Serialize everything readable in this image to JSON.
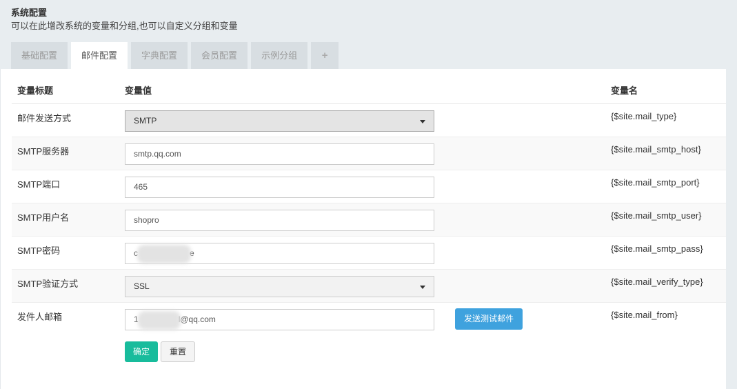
{
  "header": {
    "title": "系统配置",
    "description": "可以在此增改系统的变量和分组,也可以自定义分组和变量"
  },
  "tabs": [
    {
      "label": "基础配置",
      "active": false
    },
    {
      "label": "邮件配置",
      "active": true
    },
    {
      "label": "字典配置",
      "active": false
    },
    {
      "label": "会员配置",
      "active": false
    },
    {
      "label": "示例分组",
      "active": false
    },
    {
      "label": "+",
      "active": false
    }
  ],
  "table": {
    "headers": {
      "title": "变量标题",
      "value": "变量值",
      "name": "变量名"
    },
    "rows": [
      {
        "title": "邮件发送方式",
        "value": "SMTP",
        "name": "{$site.mail_type}",
        "type": "select"
      },
      {
        "title": "SMTP服务器",
        "value": "smtp.qq.com",
        "name": "{$site.mail_smtp_host}",
        "type": "input"
      },
      {
        "title": "SMTP端口",
        "value": "465",
        "name": "{$site.mail_smtp_port}",
        "type": "input"
      },
      {
        "title": "SMTP用户名",
        "value": "shopro",
        "name": "{$site.mail_smtp_user}",
        "type": "input"
      },
      {
        "title": "SMTP密码",
        "value_start": "c",
        "value_end": "e",
        "name": "{$site.mail_smtp_pass}",
        "type": "input-redacted"
      },
      {
        "title": "SMTP验证方式",
        "value": "SSL",
        "name": "{$site.mail_verify_type}",
        "type": "select"
      },
      {
        "title": "发件人邮箱",
        "value_start": "1",
        "value_end": "l@qq.com",
        "name": "{$site.mail_from}",
        "type": "input-redacted"
      }
    ],
    "test_button": "发送测试邮件"
  },
  "actions": {
    "confirm": "确定",
    "reset": "重置"
  },
  "colors": {
    "confirm_button": "#18bc9c",
    "test_button": "#3fa2de",
    "header_bg": "#e8edf0"
  }
}
